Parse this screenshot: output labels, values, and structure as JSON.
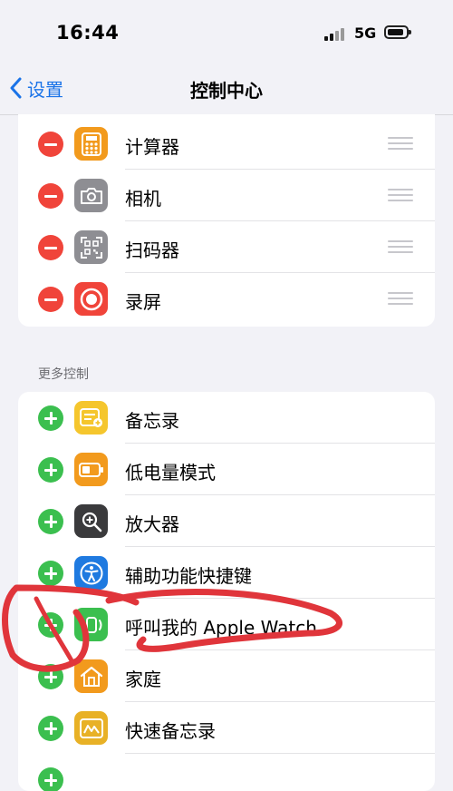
{
  "status_bar": {
    "time": "16:44",
    "network": "5G"
  },
  "nav": {
    "back_label": "设置",
    "title": "控制中心"
  },
  "included_controls": [
    {
      "label": "计算器"
    },
    {
      "label": "相机"
    },
    {
      "label": "扫码器"
    },
    {
      "label": "录屏"
    }
  ],
  "more_controls": {
    "header": "更多控制",
    "items": [
      {
        "label": "备忘录"
      },
      {
        "label": "低电量模式"
      },
      {
        "label": "放大器"
      },
      {
        "label": "辅助功能快捷键"
      },
      {
        "label": "呼叫我的 Apple Watch"
      },
      {
        "label": "家庭"
      },
      {
        "label": "快速备忘录"
      }
    ]
  },
  "colors": {
    "remove": "#f0443a",
    "add": "#3bbf4f",
    "link": "#1a73e8",
    "annotation": "#e0353b",
    "calculator": "#f29a1d",
    "camera": "#8e8e93",
    "scanner": "#8e8e93",
    "screen_record": "#f0443a",
    "notes": "#f5c62d",
    "low_power": "#f29a1d",
    "magnifier": "#3a3a3c",
    "accessibility": "#1f7ae0",
    "ping_watch": "#3bbf4f",
    "home": "#f29a1d",
    "quick_note": "#e8b126"
  }
}
